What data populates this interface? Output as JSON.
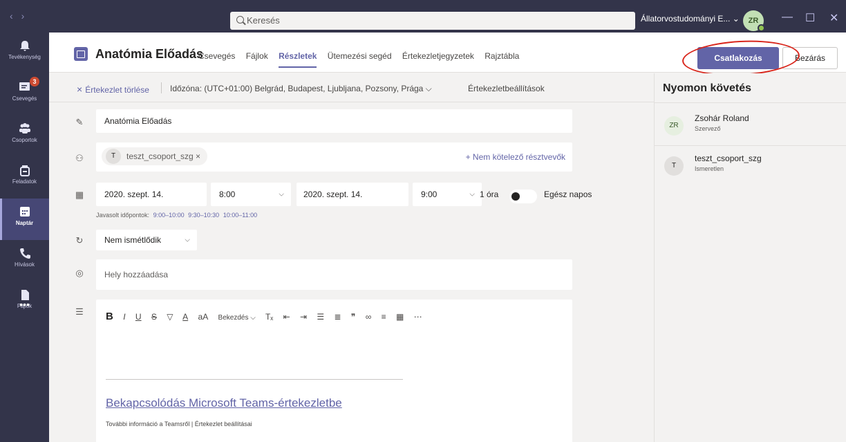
{
  "titlebar": {
    "search_placeholder": "Keresés",
    "org_name": "Állatorvostudományi E... ⌄",
    "avatar_initials": "ZR"
  },
  "rail": {
    "items": [
      {
        "label": "Tevékenység"
      },
      {
        "label": "Csevegés",
        "badge": "3"
      },
      {
        "label": "Csoportok"
      },
      {
        "label": "Feladatok"
      },
      {
        "label": "Naptár"
      },
      {
        "label": "Hívások"
      },
      {
        "label": "Fájlok"
      },
      {
        "label": "•••"
      }
    ]
  },
  "header": {
    "title": "Anatómia Előadás",
    "tabs": [
      "Csevegés",
      "Fájlok",
      "Részletek",
      "Ütemezési segéd",
      "Értekezletjegyzetek",
      "Rajztábla"
    ],
    "join_label": "Csatlakozás",
    "close_label": "Bezárás"
  },
  "toolbar": {
    "delete_label": "Értekezlet törlése",
    "timezone": "Időzóna: (UTC+01:00) Belgrád, Budapest, Ljubljana, Pozsony, Prága ⌵",
    "settings_label": "Értekezletbeállítások"
  },
  "form": {
    "title_value": "Anatómia Előadás",
    "attendee": {
      "initial": "T",
      "name": "teszt_csoport_szg ×"
    },
    "optional_label": "+ Nem kötelező résztvevők",
    "start_date": "2020. szept. 14.",
    "start_time": "8:00",
    "end_date": "2020. szept. 14.",
    "end_time": "9:00",
    "duration": "1 óra",
    "all_day_label": "Egész napos",
    "suggested_label": "Javasolt időpontok:",
    "suggested_times": [
      "9:00–10:00",
      "9:30–10:30",
      "10:00–11:00"
    ],
    "repeat_value": "Nem ismétlődik",
    "location_placeholder": "Hely hozzáadása",
    "editor": {
      "paragraph_label": "Bekezdés ⌵",
      "join_link": "Bekapcsolódás Microsoft Teams-értekezletbe",
      "more_info": "További információ a Teamsről | Értekezlet beállításai"
    }
  },
  "side": {
    "title": "Nyomon követés",
    "people": [
      {
        "initials": "ZR",
        "name": "Zsohár Roland",
        "role": "Szervező"
      },
      {
        "initials": "T",
        "name": "teszt_csoport_szg",
        "role": "Ismeretlen"
      }
    ]
  },
  "colors": {
    "accent": "#6264a7",
    "rail": "#33344a",
    "annotation": "#d9261c"
  }
}
